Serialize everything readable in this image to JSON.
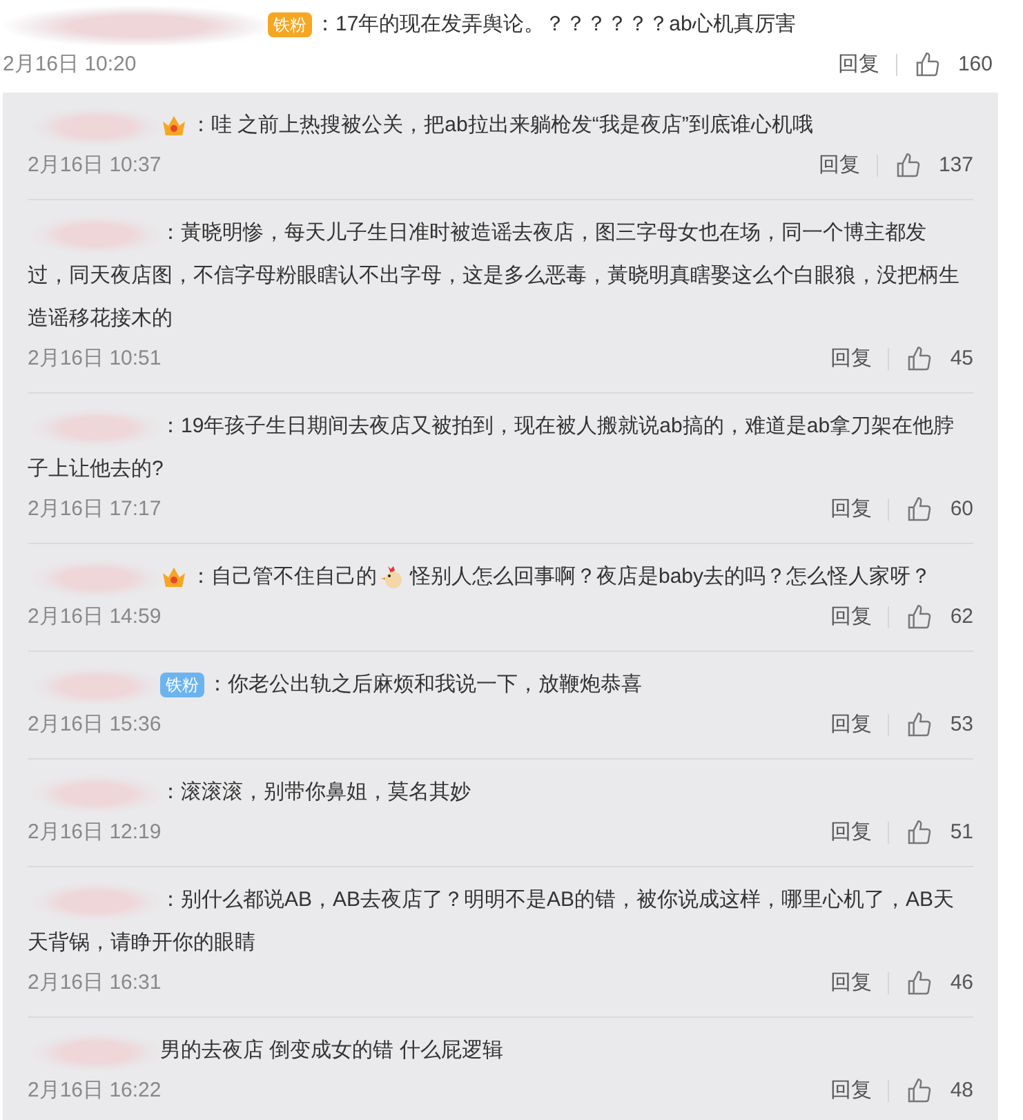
{
  "comment": {
    "badge": {
      "kind": "tag",
      "text": "铁粉",
      "color": "#f5a623"
    },
    "segments": [
      {
        "kind": "text",
        "text": "：17年的现在发弄舆论。？？？？？？ab心机真厉害"
      }
    ],
    "time": "2月16日 10:20",
    "reply_label": "回复",
    "likes": "160"
  },
  "replies": [
    {
      "badge": {
        "kind": "crown"
      },
      "segments": [
        {
          "kind": "text",
          "text": "：哇 之前上热搜被公关，把ab拉出来躺枪发“我是夜店”到底谁心机哦"
        }
      ],
      "time": "2月16日 10:37",
      "reply_label": "回复",
      "likes": "137"
    },
    {
      "segments": [
        {
          "kind": "text",
          "text": "：黃晓明惨，每天儿子生日准时被造谣去夜店，图三字母女也在场，同一个博主都发过，同天夜店图，不信字母粉眼瞎认不出字母，这是多么恶毒，黃晓明真瞎娶这么个白眼狼，没把柄生造谣移花接木的"
        }
      ],
      "time": "2月16日 10:51",
      "reply_label": "回复",
      "likes": "45"
    },
    {
      "segments": [
        {
          "kind": "text",
          "text": "：19年孩子生日期间去夜店又被拍到，现在被人搬就说ab搞的，难道是ab拿刀架在他脖子上让他去的?"
        }
      ],
      "time": "2月16日 17:17",
      "reply_label": "回复",
      "likes": "60"
    },
    {
      "badge": {
        "kind": "crown"
      },
      "segments": [
        {
          "kind": "text",
          "text": "：自己管不住自己的"
        },
        {
          "kind": "emoji"
        },
        {
          "kind": "text",
          "text": "怪别人怎么回事啊？夜店是baby去的吗？怎么怪人家呀？"
        }
      ],
      "time": "2月16日 14:59",
      "reply_label": "回复",
      "likes": "62"
    },
    {
      "badge": {
        "kind": "tag",
        "text": "铁粉",
        "color": "#6cb4f0"
      },
      "segments": [
        {
          "kind": "text",
          "text": "：你老公出轨之后麻烦和我说一下，放鞭炮恭喜"
        }
      ],
      "time": "2月16日 15:36",
      "reply_label": "回复",
      "likes": "53"
    },
    {
      "segments": [
        {
          "kind": "text",
          "text": "：滚滚滚，别带你鼻姐，莫名其妙"
        }
      ],
      "time": "2月16日 12:19",
      "reply_label": "回复",
      "likes": "51"
    },
    {
      "segments": [
        {
          "kind": "text",
          "text": "：别什么都说AB，AB去夜店了？明明不是AB的错，被你说成这样，哪里心机了，AB天天背锅，请睁开你的眼睛"
        }
      ],
      "time": "2月16日 16:31",
      "reply_label": "回复",
      "likes": "46"
    },
    {
      "segments": [
        {
          "kind": "text",
          "text": "男的去夜店 倒变成女的错 什么屁逻辑"
        }
      ],
      "time": "2月16日 16:22",
      "reply_label": "回复",
      "likes": "48"
    }
  ]
}
